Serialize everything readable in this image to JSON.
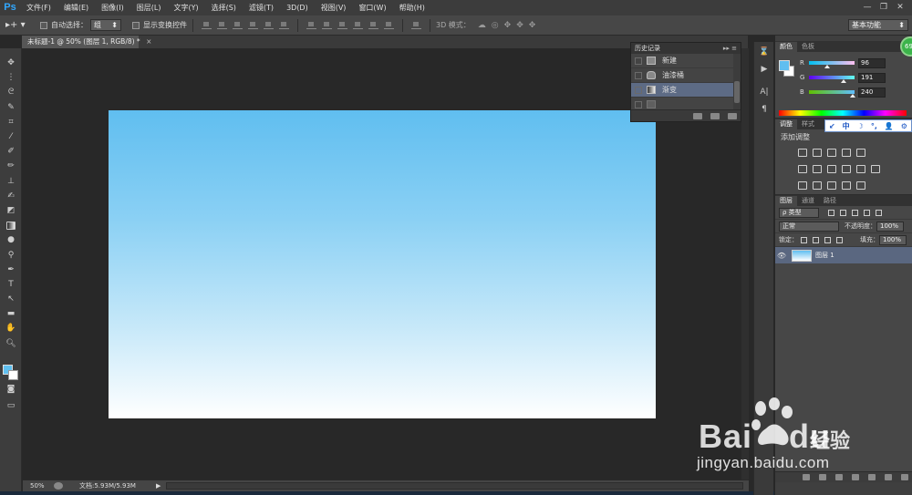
{
  "menubar": {
    "logo": "Ps",
    "items": [
      "文件(F)",
      "编辑(E)",
      "图像(I)",
      "图层(L)",
      "文字(Y)",
      "选择(S)",
      "滤镜(T)",
      "3D(D)",
      "视图(V)",
      "窗口(W)",
      "帮助(H)"
    ],
    "window_controls": {
      "minimize": "—",
      "restore": "❐",
      "close": "✕"
    }
  },
  "options": {
    "tool_glyph": "▸+ ▾",
    "auto_select_label": "自动选择：",
    "auto_select_value": "组",
    "show_transform_label": "显示变换控件",
    "mode_3d_label": "3D 模式：",
    "workspace": "基本功能"
  },
  "document": {
    "tab_title": "未标题-1 @ 50% (图层 1, RGB/8) *",
    "close_glyph": "×",
    "gradient_colors": [
      "#60bef0",
      "#ffffff"
    ]
  },
  "toolbox": {
    "tools": [
      "move-tool",
      "marquee-tool",
      "lasso-tool",
      "quick-select-tool",
      "crop-tool",
      "eyedropper-tool",
      "healing-brush-tool",
      "brush-tool",
      "clone-stamp-tool",
      "history-brush-tool",
      "eraser-tool",
      "gradient-tool",
      "blur-tool",
      "dodge-tool",
      "pen-tool",
      "type-tool",
      "path-select-tool",
      "rectangle-tool",
      "hand-tool",
      "zoom-tool"
    ],
    "foreground_color": "#60c0f0",
    "background_color": "#ffffff"
  },
  "history": {
    "title": "历史记录",
    "menu_glyph": "▸▸ ≡",
    "items": [
      {
        "label": "新建",
        "state": "normal"
      },
      {
        "label": "油漆桶",
        "state": "normal"
      },
      {
        "label": "渐变",
        "state": "selected"
      },
      {
        "label": "",
        "state": "dim"
      }
    ]
  },
  "color_panel": {
    "tabs": [
      "颜色",
      "色板"
    ],
    "r_label": "R",
    "r_value": "96",
    "g_label": "G",
    "g_value": "191",
    "b_label": "B",
    "b_value": "240"
  },
  "adjust_panel": {
    "tabs": [
      "调整",
      "样式"
    ],
    "title": "添加调整",
    "ime": [
      "↙",
      "中",
      "☽",
      "°,",
      "👤",
      "⚙"
    ]
  },
  "layers_panel": {
    "tabs": [
      "图层",
      "通道",
      "路径"
    ],
    "filter_label": "ρ 类型",
    "blend_mode": "正常",
    "opacity_label": "不透明度：",
    "opacity_value": "100%",
    "lock_label": "锁定：",
    "fill_label": "填充：",
    "fill_value": "100%",
    "layers": [
      {
        "name": "图层 1",
        "visible_glyph": "👁"
      }
    ]
  },
  "status": {
    "zoom": "50%",
    "doc_size": "文档:5.93M/5.93M",
    "arrow": "▶"
  },
  "watermark": {
    "brand_latin": "Bai",
    "brand_latin_2": "du",
    "brand_cn": "经验",
    "url": "jingyan.baidu.com"
  },
  "badge": "69"
}
